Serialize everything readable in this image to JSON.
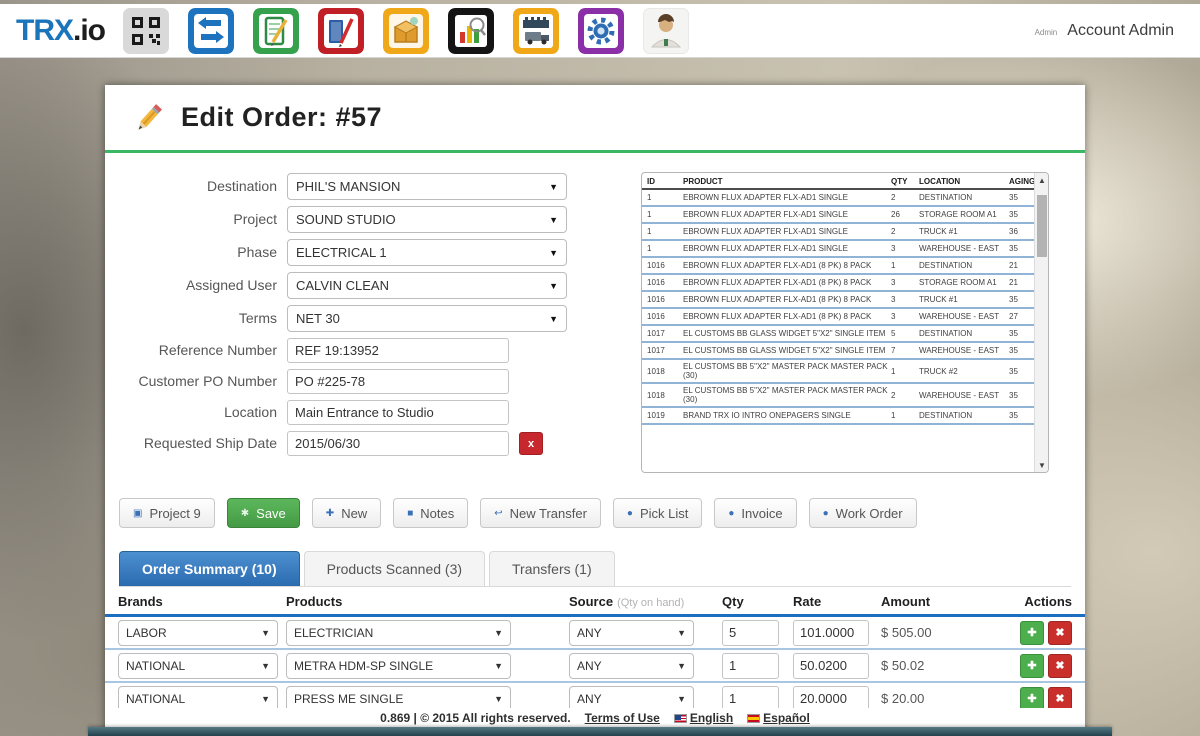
{
  "navbar": {
    "logo_primary": "TRX",
    "logo_secondary": ".io",
    "account_small": "Admin",
    "account_name": "Account Admin",
    "icons": [
      "qr-code-icon",
      "transfers-icon",
      "orders-icon",
      "catalog-icon",
      "packages-icon",
      "reports-icon",
      "schedule-icon",
      "settings-icon",
      "account-icon"
    ]
  },
  "page": {
    "title": "Edit Order: #57"
  },
  "form": {
    "fields": [
      {
        "label": "Destination",
        "value": "PHIL'S MANSION",
        "type": "select"
      },
      {
        "label": "Project",
        "value": "SOUND STUDIO",
        "type": "select"
      },
      {
        "label": "Phase",
        "value": "ELECTRICAL 1",
        "type": "select"
      },
      {
        "label": "Assigned User",
        "value": "CALVIN CLEAN",
        "type": "select"
      },
      {
        "label": "Terms",
        "value": "NET 30",
        "type": "select"
      },
      {
        "label": "Reference Number",
        "value": "REF 19:13952",
        "type": "text"
      },
      {
        "label": "Customer PO Number",
        "value": "PO #225-78",
        "type": "text"
      },
      {
        "label": "Location",
        "value": "Main Entrance to Studio",
        "type": "text"
      },
      {
        "label": "Requested Ship Date",
        "value": "2015/06/30",
        "type": "date"
      }
    ],
    "date_clear_glyph": "x"
  },
  "inventory": {
    "headers": {
      "id": "ID",
      "product": "PRODUCT",
      "qty": "QTY",
      "location": "LOCATION",
      "aging": "AGING"
    },
    "rows": [
      {
        "id": "1",
        "product": "EBROWN FLUX ADAPTER FLX-AD1 SINGLE",
        "qty": "2",
        "location": "DESTINATION",
        "aging": "35"
      },
      {
        "id": "1",
        "product": "EBROWN FLUX ADAPTER FLX-AD1 SINGLE",
        "qty": "26",
        "location": "STORAGE ROOM A1",
        "aging": "35"
      },
      {
        "id": "1",
        "product": "EBROWN FLUX ADAPTER FLX-AD1 SINGLE",
        "qty": "2",
        "location": "TRUCK #1",
        "aging": "36"
      },
      {
        "id": "1",
        "product": "EBROWN FLUX ADAPTER FLX-AD1 SINGLE",
        "qty": "3",
        "location": "WAREHOUSE - EAST",
        "aging": "35"
      },
      {
        "id": "1016",
        "product": "EBROWN FLUX ADAPTER FLX-AD1 (8 PK) 8 PACK",
        "qty": "1",
        "location": "DESTINATION",
        "aging": "21"
      },
      {
        "id": "1016",
        "product": "EBROWN FLUX ADAPTER FLX-AD1 (8 PK) 8 PACK",
        "qty": "3",
        "location": "STORAGE ROOM A1",
        "aging": "21"
      },
      {
        "id": "1016",
        "product": "EBROWN FLUX ADAPTER FLX-AD1 (8 PK) 8 PACK",
        "qty": "3",
        "location": "TRUCK #1",
        "aging": "35"
      },
      {
        "id": "1016",
        "product": "EBROWN FLUX ADAPTER FLX-AD1 (8 PK) 8 PACK",
        "qty": "3",
        "location": "WAREHOUSE - EAST",
        "aging": "27"
      },
      {
        "id": "1017",
        "product": "EL CUSTOMS BB GLASS WIDGET 5\"X2\" SINGLE ITEM",
        "qty": "5",
        "location": "DESTINATION",
        "aging": "35"
      },
      {
        "id": "1017",
        "product": "EL CUSTOMS BB GLASS WIDGET 5\"X2\" SINGLE ITEM",
        "qty": "7",
        "location": "WAREHOUSE - EAST",
        "aging": "35"
      },
      {
        "id": "1018",
        "product": "EL CUSTOMS BB 5\"X2\" MASTER PACK MASTER PACK (30)",
        "qty": "1",
        "location": "TRUCK #2",
        "aging": "35"
      },
      {
        "id": "1018",
        "product": "EL CUSTOMS BB 5\"X2\" MASTER PACK MASTER PACK (30)",
        "qty": "2",
        "location": "WAREHOUSE - EAST",
        "aging": "35"
      },
      {
        "id": "1019",
        "product": "BRAND TRX IO INTRO ONEPAGERS SINGLE",
        "qty": "1",
        "location": "DESTINATION",
        "aging": "35"
      }
    ],
    "scroll_up_glyph": "▲",
    "scroll_down_glyph": "▼"
  },
  "actions": {
    "buttons": [
      {
        "label": "Project 9",
        "icon": "folder-icon",
        "glyph": "▣"
      },
      {
        "label": "Save",
        "icon": "save-icon",
        "glyph": "✱"
      },
      {
        "label": "New",
        "icon": "plus-icon",
        "glyph": "✚"
      },
      {
        "label": "Notes",
        "icon": "notes-icon",
        "glyph": "■"
      },
      {
        "label": "New Transfer",
        "icon": "transfer-arrow-icon",
        "glyph": "↩"
      },
      {
        "label": "Pick List",
        "icon": "lock-icon",
        "glyph": "●"
      },
      {
        "label": "Invoice",
        "icon": "lock-icon",
        "glyph": "●"
      },
      {
        "label": "Work Order",
        "icon": "lock-icon",
        "glyph": "●"
      }
    ]
  },
  "tabs": [
    {
      "label": "Order Summary (10)",
      "active": true
    },
    {
      "label": "Products Scanned (3)",
      "active": false
    },
    {
      "label": "Transfers (1)",
      "active": false
    }
  ],
  "summary": {
    "headers": {
      "brands": "Brands",
      "products": "Products",
      "source": "Source",
      "source_note": "(Qty on hand)",
      "qty": "Qty",
      "rate": "Rate",
      "amount": "Amount",
      "actions": "Actions"
    },
    "rows": [
      {
        "brand": "LABOR",
        "product": "ELECTRICIAN",
        "source": "ANY",
        "qty": "5",
        "rate": "101.0000",
        "amount": "$ 505.00"
      },
      {
        "brand": "NATIONAL",
        "product": "METRA HDM-SP SINGLE",
        "source": "ANY",
        "qty": "1",
        "rate": "50.0200",
        "amount": "$ 50.02"
      },
      {
        "brand": "NATIONAL",
        "product": "PRESS ME SINGLE",
        "source": "ANY",
        "qty": "1",
        "rate": "20.0000",
        "amount": "$ 20.00"
      }
    ],
    "add_glyph": "✚",
    "del_glyph": "✖"
  },
  "footer": {
    "meta": "0.869 | © 2015 All rights reserved.",
    "terms": "Terms of Use",
    "english": "English",
    "spanish": "Español"
  },
  "colors": {
    "accent_green": "#3cb864",
    "tab_blue": "#2a6bb0",
    "danger_red": "#c9302c",
    "success_green": "#4cae4c",
    "link_blue": "#1b75bb"
  }
}
